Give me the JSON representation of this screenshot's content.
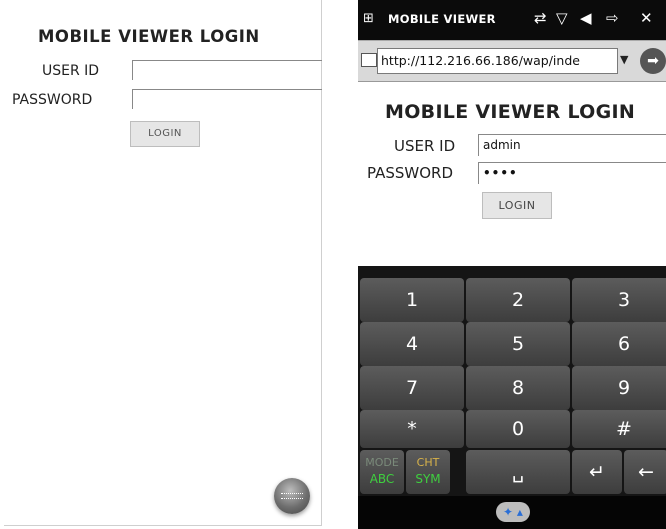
{
  "left_screen": {
    "title": "MOBILE VIEWER LOGIN",
    "user_id_label": "USER ID",
    "user_id_value": "",
    "password_label": "PASSWORD",
    "password_value": "",
    "login_button": "LOGIN",
    "floating_icon": "keyboard-bubble-icon"
  },
  "right_screen": {
    "status_bar": {
      "app_title": "MOBILE VIEWER",
      "icons": [
        "windows-start-icon",
        "data-connection-icon",
        "no-signal-icon",
        "speaker-icon",
        "battery-charge-icon",
        "close-icon"
      ]
    },
    "address_bar": {
      "url": "http://112.216.66.186/wap/inde",
      "go_icon": "go-arrow-icon"
    },
    "page": {
      "title": "MOBILE VIEWER LOGIN",
      "user_id_label": "USER ID",
      "user_id_value": "admin",
      "password_label": "PASSWORD",
      "password_value": "••••",
      "login_button": "LOGIN"
    },
    "keyboard": {
      "rows": [
        [
          "1",
          "2",
          "3"
        ],
        [
          "4",
          "5",
          "6"
        ],
        [
          "7",
          "8",
          "9"
        ],
        [
          "*",
          "0",
          "#"
        ]
      ],
      "mode_key_top": "MODE",
      "mode_key_bottom": "ABC",
      "sym_key_top": "CHT",
      "sym_key_bottom": "SYM",
      "space_symbol": "␣",
      "enter_symbol": "↵",
      "backspace_symbol": "←"
    },
    "soft_bar": {
      "sip_icon": "input-panel-icon"
    }
  },
  "colors": {
    "status_bar": "#0b0b0b",
    "key_face": "#4a4a4a",
    "key_accent_green": "#3fcf3f",
    "key_accent_yellow": "#d9b34a"
  }
}
